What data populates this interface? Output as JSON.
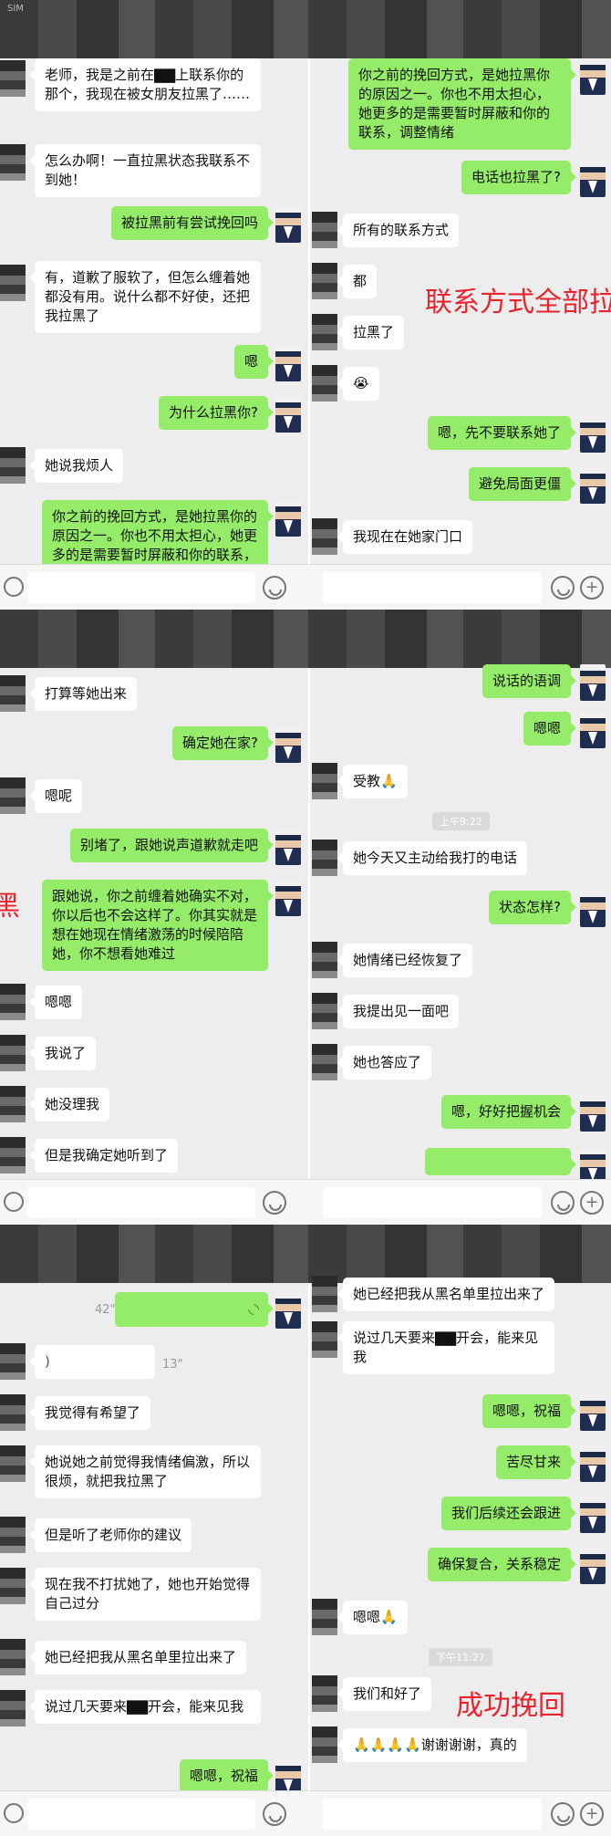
{
  "status": {
    "carrier": "SIM"
  },
  "panel1": {
    "left": [
      {
        "side": "them",
        "text": "老师，我是之前在▇▇上联系你的那个，我现在被女朋友拉黑了……"
      },
      {
        "side": "them",
        "text": "怎么办啊！一直拉黑状态我联系不到她！"
      },
      {
        "side": "me",
        "text": "被拉黑前有尝试挽回吗"
      },
      {
        "side": "them",
        "text": "有，道歉了服软了，但怎么缠着她都没有用。说什么都不好使，还把我拉黑了"
      },
      {
        "side": "me",
        "text": "嗯"
      },
      {
        "side": "me",
        "text": "为什么拉黑你?"
      },
      {
        "side": "them",
        "text": "她说我烦人"
      },
      {
        "side": "me",
        "text": "你之前的挽回方式，是她拉黑你的原因之一。你也不用太担心，她更多的是需要暂时屏蔽和你的联系，调整情绪"
      }
    ],
    "right": [
      {
        "side": "me",
        "text": "你之前的挽回方式，是她拉黑你的原因之一。你也不用太担心，她更多的是需要暂时屏蔽和你的联系，调整情绪"
      },
      {
        "side": "me",
        "text": "电话也拉黑了?"
      },
      {
        "side": "them",
        "text": "所有的联系方式"
      },
      {
        "side": "them",
        "text": "都"
      },
      {
        "side": "them",
        "text": "拉黑了"
      },
      {
        "side": "them",
        "text": "😭"
      },
      {
        "side": "me",
        "text": "嗯，先不要联系她了"
      },
      {
        "side": "me",
        "text": "避免局面更僵"
      },
      {
        "side": "them",
        "text": "我现在在她家门口"
      }
    ],
    "overlay": "联系方式全部拉"
  },
  "panel2": {
    "left": [
      {
        "side": "them",
        "text": "打算等她出来"
      },
      {
        "side": "me",
        "text": "确定她在家?"
      },
      {
        "side": "them",
        "text": "嗯呢"
      },
      {
        "side": "me",
        "text": "别堵了，跟她说声道歉就走吧"
      },
      {
        "side": "me",
        "text": "跟她说，你之前缠着她确实不对，你以后也不会这样了。你其实就是想在她现在情绪激荡的时候陪陪她，你不想看她难过"
      },
      {
        "side": "them",
        "text": "嗯嗯"
      },
      {
        "side": "them",
        "text": "我说了"
      },
      {
        "side": "them",
        "text": "她没理我"
      },
      {
        "side": "them",
        "text": "但是我确定她听到了"
      }
    ],
    "right": [
      {
        "side": "me",
        "text": "说话的语调"
      },
      {
        "side": "me",
        "text": "嗯嗯"
      },
      {
        "side": "them",
        "text": "受教🙏"
      },
      {
        "side": "time",
        "text": "上午9:22"
      },
      {
        "side": "them",
        "text": "她今天又主动给我打的电话"
      },
      {
        "side": "me",
        "text": "状态怎样?"
      },
      {
        "side": "them",
        "text": "她情绪已经恢复了"
      },
      {
        "side": "them",
        "text": "我提出见一面吧"
      },
      {
        "side": "them",
        "text": "她也答应了"
      },
      {
        "side": "me",
        "text": "嗯，好好把握机会"
      }
    ],
    "overlay": "黑"
  },
  "panel3": {
    "left": [
      {
        "side": "me",
        "text": "",
        "voice": "42\""
      },
      {
        "side": "them",
        "text": ")",
        "voice": "13\""
      },
      {
        "side": "them",
        "text": "我觉得有希望了"
      },
      {
        "side": "them",
        "text": "她说她之前觉得我情绪偏激，所以很烦，就把我拉黑了"
      },
      {
        "side": "them",
        "text": "但是听了老师你的建议"
      },
      {
        "side": "them",
        "text": "现在我不打扰她了，她也开始觉得自己过分"
      },
      {
        "side": "them",
        "text": "她已经把我从黑名单里拉出来了"
      },
      {
        "side": "them",
        "text": "说过几天要来▇▇开会，能来见我"
      },
      {
        "side": "me",
        "text": "嗯嗯，祝福"
      }
    ],
    "right": [
      {
        "side": "them",
        "text": "她已经把我从黑名单里拉出来了"
      },
      {
        "side": "them",
        "text": "说过几天要来▇▇开会，能来见我"
      },
      {
        "side": "me",
        "text": "嗯嗯，祝福"
      },
      {
        "side": "me",
        "text": "苦尽甘来"
      },
      {
        "side": "me",
        "text": "我们后续还会跟进"
      },
      {
        "side": "me",
        "text": "确保复合，关系稳定"
      },
      {
        "side": "them",
        "text": "嗯嗯🙏"
      },
      {
        "side": "time",
        "text": "下午11:27"
      },
      {
        "side": "them",
        "text": "我们和好了"
      },
      {
        "side": "them",
        "text": "🙏🙏🙏🙏谢谢谢谢，真的"
      }
    ],
    "overlay": "成功挽回"
  }
}
